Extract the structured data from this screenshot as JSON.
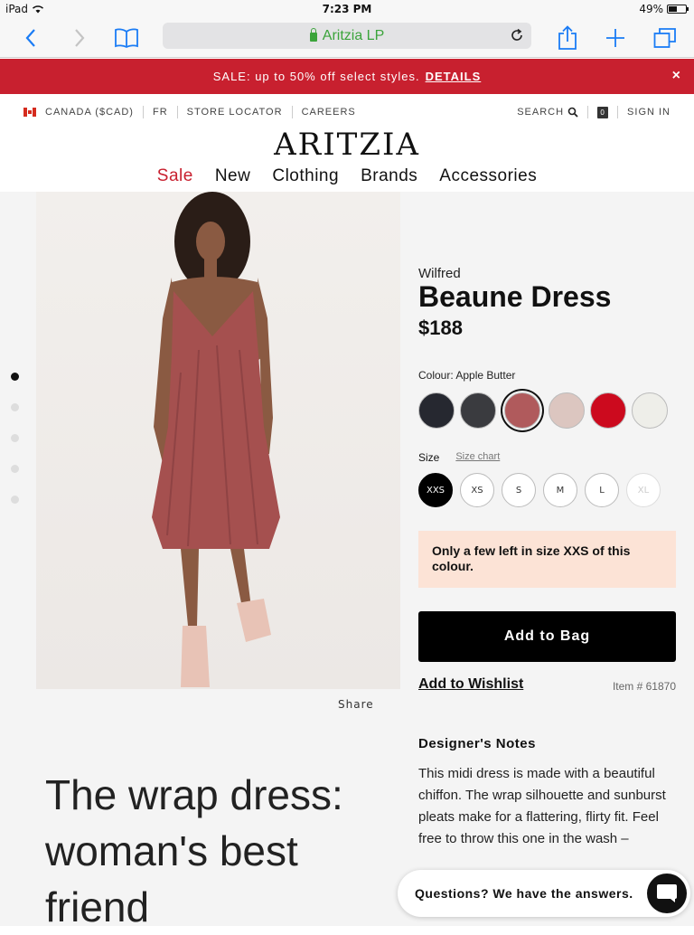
{
  "status_bar": {
    "device": "iPad",
    "time": "7:23 PM",
    "battery": "49%",
    "battery_level": 0.49
  },
  "browser": {
    "url_title": "Aritzia LP"
  },
  "sale_banner": {
    "text": "SALE: up to 50% off select styles.",
    "link": "DETAILS",
    "close": "×"
  },
  "utility_nav": {
    "country": "CANADA ($CAD)",
    "lang": "FR",
    "store_locator": "STORE LOCATOR",
    "careers": "CAREERS",
    "search": "SEARCH",
    "bag_count": "0",
    "sign_in": "SIGN IN"
  },
  "logo": "ARITZIA",
  "main_nav": {
    "sale": "Sale",
    "new": "New",
    "clothing": "Clothing",
    "brands": "Brands",
    "accessories": "Accessories"
  },
  "product": {
    "brand": "Wilfred",
    "name": "Beaune Dress",
    "price": "$188",
    "colour_label": "Colour: Apple Butter",
    "colours": [
      "#262830",
      "#3a3b3f",
      "#b05a5c",
      "#dcc6c0",
      "#cc0a1e",
      "#eeeee9"
    ],
    "size_label": "Size",
    "size_chart": "Size chart",
    "sizes": [
      "XXS",
      "XS",
      "S",
      "M",
      "L",
      "XL"
    ],
    "alert": "Only a few left in size XXS of this colour.",
    "add_to_bag": "Add to Bag",
    "add_to_wishlist": "Add to Wishlist",
    "item_number": "Item # 61870",
    "designer_notes_title": "Designer's Notes",
    "designer_notes": "This midi dress is made with a beautiful chiffon. The wrap silhouette and sunburst pleats make for a flattering, flirty fit. Feel free to throw this one in the wash –"
  },
  "gallery": {
    "share": "Share"
  },
  "article": {
    "title": "The wrap dress: woman's best friend"
  },
  "chat": {
    "text": "Questions? We have the answers."
  },
  "colors": {
    "sale_red": "#c8202f",
    "ios_blue": "#1a7cf5",
    "secure_green": "#3ba43b",
    "alert_bg": "#fce3d6"
  }
}
